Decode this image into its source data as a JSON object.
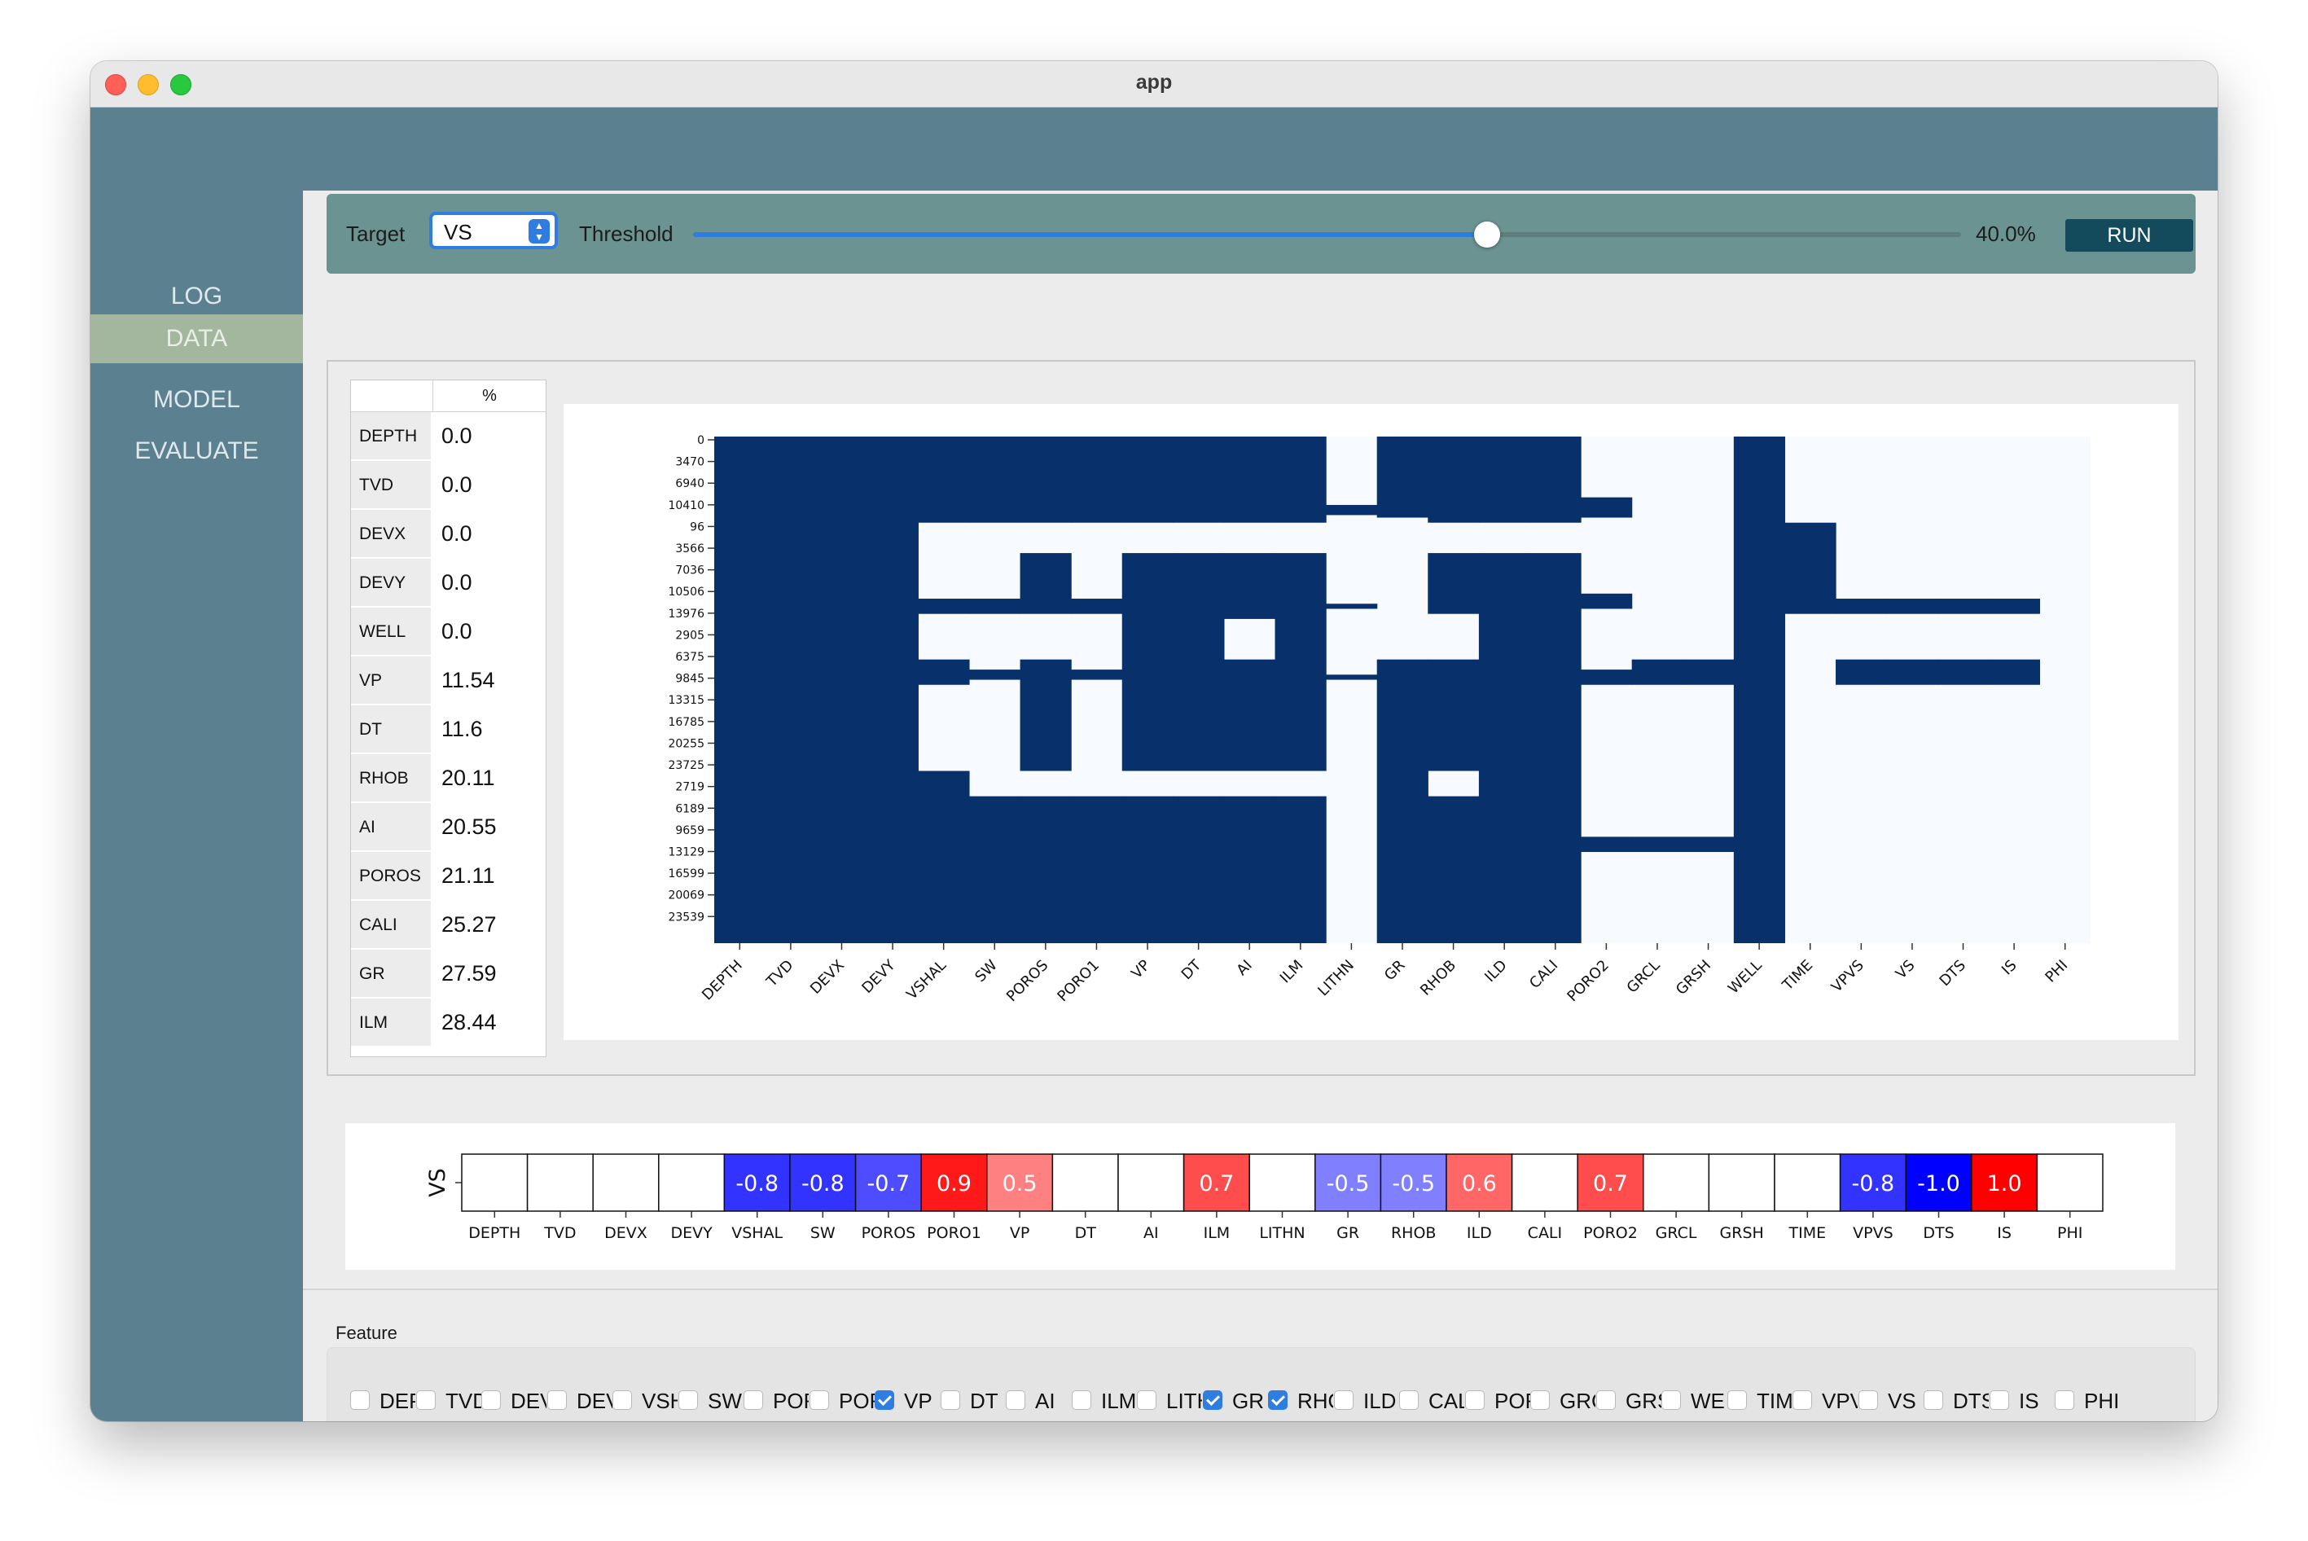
{
  "window": {
    "title": "app"
  },
  "sidebar": {
    "items": [
      {
        "label": "LOG",
        "active": false
      },
      {
        "label": "DATA",
        "active": true
      },
      {
        "label": "MODEL",
        "active": false
      },
      {
        "label": "EVALUATE",
        "active": false
      }
    ]
  },
  "toolbar": {
    "target_label": "Target",
    "target_value": "VS",
    "threshold_label": "Threshold",
    "threshold_value": "40.0%",
    "threshold_fraction": 0.4,
    "run_label": "RUN",
    "accent_color": "#2f7de1"
  },
  "missing_table": {
    "header": "%",
    "rows": [
      {
        "name": "DEPTH",
        "value": "0.0"
      },
      {
        "name": "TVD",
        "value": "0.0"
      },
      {
        "name": "DEVX",
        "value": "0.0"
      },
      {
        "name": "DEVY",
        "value": "0.0"
      },
      {
        "name": "WELL",
        "value": "0.0"
      },
      {
        "name": "VP",
        "value": "11.54"
      },
      {
        "name": "DT",
        "value": "11.6"
      },
      {
        "name": "RHOB",
        "value": "20.11"
      },
      {
        "name": "AI",
        "value": "20.55"
      },
      {
        "name": "POROS",
        "value": "21.11"
      },
      {
        "name": "CALI",
        "value": "25.27"
      },
      {
        "name": "GR",
        "value": "27.59"
      },
      {
        "name": "ILM",
        "value": "28.44"
      }
    ]
  },
  "chart_data": [
    {
      "type": "heatmap",
      "title": "",
      "colors": {
        "present": "#08306b",
        "missing": "#f7fbff"
      },
      "columns": [
        "DEPTH",
        "TVD",
        "DEVX",
        "DEVY",
        "VSHAL",
        "SW",
        "POROS",
        "PORO1",
        "VP",
        "DT",
        "AI",
        "ILM",
        "LITHN",
        "GR",
        "RHOB",
        "ILD",
        "CALI",
        "PORO2",
        "GRCL",
        "GRSH",
        "WELL",
        "TIME",
        "VPVS",
        "VS",
        "DTS",
        "IS",
        "PHI"
      ],
      "y_ticks": [
        "0",
        "3470",
        "6940",
        "10410",
        "96",
        "3566",
        "7036",
        "10506",
        "13976",
        "2905",
        "6375",
        "9845",
        "13315",
        "16785",
        "20255",
        "23725",
        "2719",
        "6189",
        "9659",
        "13129",
        "16599",
        "20069",
        "23539"
      ],
      "present_ranges": [
        [
          [
            0,
            1
          ]
        ],
        [
          [
            0,
            1
          ]
        ],
        [
          [
            0,
            1
          ]
        ],
        [
          [
            0,
            1
          ]
        ],
        [
          [
            0,
            0.17
          ],
          [
            0.32,
            0.35
          ],
          [
            0.44,
            0.49
          ],
          [
            0.66,
            1
          ]
        ],
        [
          [
            0,
            0.17
          ],
          [
            0.32,
            0.35
          ],
          [
            0.46,
            0.48
          ],
          [
            0.71,
            1
          ]
        ],
        [
          [
            0,
            0.17
          ],
          [
            0.23,
            0.35
          ],
          [
            0.44,
            0.66
          ],
          [
            0.71,
            1
          ]
        ],
        [
          [
            0,
            0.17
          ],
          [
            0.32,
            0.35
          ],
          [
            0.46,
            0.48
          ],
          [
            0.71,
            1
          ]
        ],
        [
          [
            0,
            0.17
          ],
          [
            0.23,
            0.66
          ],
          [
            0.71,
            1
          ]
        ],
        [
          [
            0,
            0.17
          ],
          [
            0.23,
            0.66
          ],
          [
            0.71,
            1
          ]
        ],
        [
          [
            0,
            0.17
          ],
          [
            0.23,
            0.36
          ],
          [
            0.44,
            0.66
          ],
          [
            0.71,
            1
          ]
        ],
        [
          [
            0,
            0.17
          ],
          [
            0.23,
            0.66
          ],
          [
            0.71,
            1
          ]
        ],
        [
          [
            0.135,
            0.155
          ],
          [
            0.33,
            0.34
          ],
          [
            0.47,
            0.48
          ]
        ],
        [
          [
            0,
            0.16
          ],
          [
            0.44,
            1
          ]
        ],
        [
          [
            0,
            0.17
          ],
          [
            0.23,
            0.35
          ],
          [
            0.44,
            0.66
          ],
          [
            0.71,
            1
          ]
        ],
        [
          [
            0,
            0.17
          ],
          [
            0.23,
            1
          ]
        ],
        [
          [
            0,
            0.17
          ],
          [
            0.23,
            1
          ]
        ],
        [
          [
            0.12,
            0.16
          ],
          [
            0.31,
            0.34
          ],
          [
            0.46,
            0.49
          ],
          [
            0.79,
            0.82
          ]
        ],
        [
          [
            0.44,
            0.49
          ],
          [
            0.79,
            0.82
          ]
        ],
        [
          [
            0.44,
            0.49
          ],
          [
            0.79,
            0.82
          ]
        ],
        [
          [
            0,
            1
          ]
        ],
        [
          [
            0.17,
            0.35
          ]
        ],
        [
          [
            0.32,
            0.35
          ],
          [
            0.44,
            0.49
          ]
        ],
        [
          [
            0.32,
            0.35
          ],
          [
            0.44,
            0.49
          ]
        ],
        [
          [
            0.32,
            0.35
          ],
          [
            0.44,
            0.49
          ]
        ],
        [
          [
            0.32,
            0.35
          ],
          [
            0.44,
            0.49
          ]
        ],
        []
      ]
    },
    {
      "type": "heatmap",
      "ylabel": "VS",
      "columns": [
        "DEPTH",
        "TVD",
        "DEVX",
        "DEVY",
        "VSHAL",
        "SW",
        "POROS",
        "PORO1",
        "VP",
        "DT",
        "AI",
        "ILM",
        "LITHN",
        "GR",
        "RHOB",
        "ILD",
        "CALI",
        "PORO2",
        "GRCL",
        "GRSH",
        "TIME",
        "VPVS",
        "DTS",
        "IS",
        "PHI"
      ],
      "values": [
        null,
        null,
        null,
        null,
        -0.8,
        -0.8,
        -0.7,
        0.9,
        0.5,
        null,
        null,
        0.7,
        null,
        -0.5,
        -0.5,
        0.6,
        null,
        0.7,
        null,
        null,
        null,
        -0.8,
        -1.0,
        1.0,
        null
      ],
      "labels": [
        "",
        "",
        "",
        "",
        "-0.8",
        "-0.8",
        "-0.7",
        "0.9",
        "0.5",
        "",
        "",
        "0.7",
        "",
        "-0.5",
        "-0.5",
        "0.6",
        "",
        "0.7",
        "",
        "",
        "",
        "-0.8",
        "-1.0",
        "1.0",
        ""
      ],
      "vmin": -1.0,
      "vmax": 1.0
    }
  ],
  "features": {
    "title": "Feature",
    "items": [
      {
        "label": "DEPTH",
        "checked": false
      },
      {
        "label": "TVD",
        "checked": false
      },
      {
        "label": "DEVX",
        "checked": false
      },
      {
        "label": "DEVY",
        "checked": false
      },
      {
        "label": "VSHAL",
        "checked": false
      },
      {
        "label": "SW",
        "checked": false
      },
      {
        "label": "POROS",
        "checked": false
      },
      {
        "label": "PORO1",
        "checked": false
      },
      {
        "label": "VP",
        "checked": true
      },
      {
        "label": "DT",
        "checked": false
      },
      {
        "label": "AI",
        "checked": false
      },
      {
        "label": "ILM",
        "checked": false
      },
      {
        "label": "LITHN",
        "checked": false
      },
      {
        "label": "GR",
        "checked": true
      },
      {
        "label": "RHOB",
        "checked": true
      },
      {
        "label": "ILD",
        "checked": false
      },
      {
        "label": "CALI",
        "checked": false
      },
      {
        "label": "PORO2",
        "checked": false
      },
      {
        "label": "GRCL",
        "checked": false
      },
      {
        "label": "GRSH",
        "checked": false
      },
      {
        "label": "WELL",
        "checked": false
      },
      {
        "label": "TIME",
        "checked": false
      },
      {
        "label": "VPVS",
        "checked": false
      },
      {
        "label": "VS",
        "checked": false
      },
      {
        "label": "DTS",
        "checked": false
      },
      {
        "label": "IS",
        "checked": false
      },
      {
        "label": "PHI",
        "checked": false
      }
    ]
  }
}
